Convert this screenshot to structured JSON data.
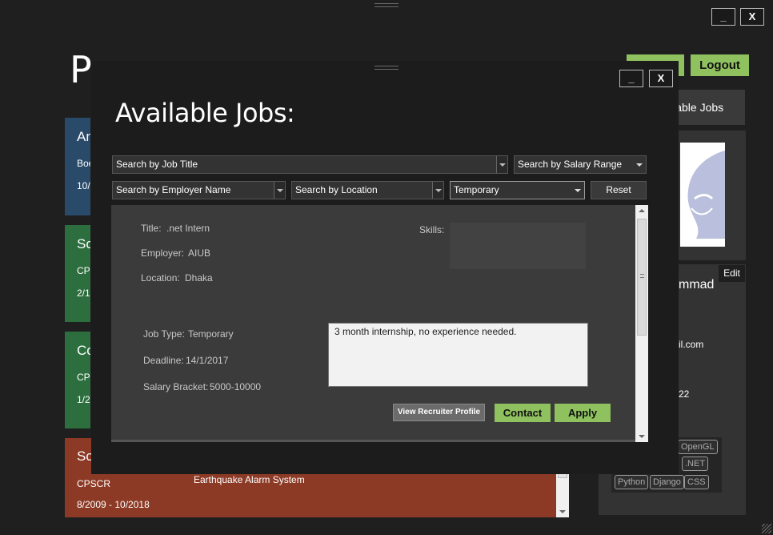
{
  "background_window": {
    "title_partial": "Pro",
    "action_button_partial": "...",
    "logout_label": "Logout",
    "available_jobs_partial": "ilable Jobs",
    "edit_label": "Edit",
    "name_partial": "mmad",
    "email_partial": "il.com",
    "number_partial": "22",
    "cards": [
      {
        "color": "#2a4a6a",
        "heading": "An",
        "line1": "Boe",
        "line2": "10/"
      },
      {
        "color": "#2d6e3e",
        "heading": "So",
        "line1": "CPS",
        "line2": "2/1"
      },
      {
        "color": "#2d6e3e",
        "heading": "Co",
        "line1": "CPS",
        "line2": "1/2"
      },
      {
        "color": "#8c3a25",
        "heading": "So",
        "line1": "CPSCR",
        "line2": "8/2009 - 10/2018",
        "project": "Earthquake Alarm System"
      }
    ],
    "skills": [
      "OpenGL",
      ".NET",
      "Python",
      "Django",
      "CSS"
    ]
  },
  "window_controls": {
    "minimize": "_",
    "close": "X"
  },
  "modal": {
    "title": "Available Jobs:",
    "search": {
      "job_title_placeholder": "Search by Job Title",
      "salary_range_placeholder": "Search by Salary Range",
      "employer_placeholder": "Search by Employer Name",
      "location_placeholder": "Search by Location",
      "job_type_value": "Temporary",
      "reset_label": "Reset"
    },
    "job": {
      "title_label": "Title:",
      "title": ".net Intern",
      "employer_label": "Employer:",
      "employer": "AIUB",
      "location_label": "Location:",
      "location": "Dhaka",
      "skills_label": "Skills:",
      "job_type_label": "Job Type:",
      "job_type": "Temporary",
      "deadline_label": "Deadline:",
      "deadline": "14/1/2017",
      "salary_label": "Salary Bracket:",
      "salary": "5000-10000",
      "description": "3 month internship, no experience needed.",
      "view_recruiter_label": "View Recruiter Profile",
      "contact_label": "Contact",
      "apply_label": "Apply"
    }
  }
}
